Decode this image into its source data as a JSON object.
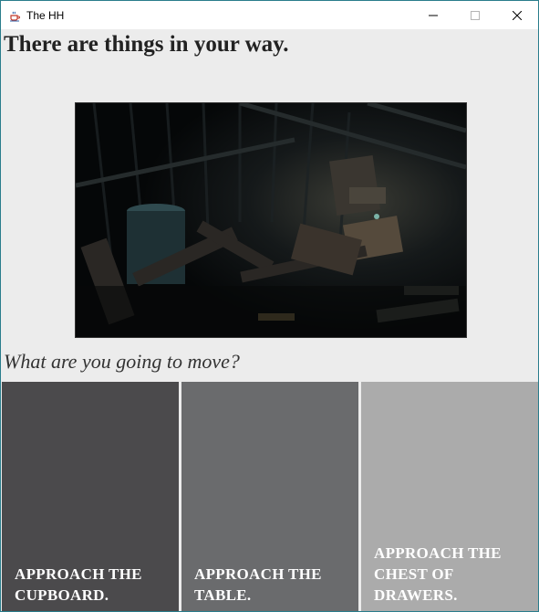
{
  "window": {
    "title": "The HH",
    "icon": "java-cup-icon"
  },
  "main": {
    "headline": "There are things in your way.",
    "scene_image": "dark-attic-clutter-image",
    "question": "What are you going to move?"
  },
  "choices": [
    {
      "label": "APPROACH THE\nCUPBOARD.",
      "color": "#4b4a4c"
    },
    {
      "label": "APPROACH THE\nTABLE.",
      "color": "#6a6b6d"
    },
    {
      "label": "APPROACH THE\nCHEST OF\nDRAWERS.",
      "color": "#ababab"
    }
  ]
}
